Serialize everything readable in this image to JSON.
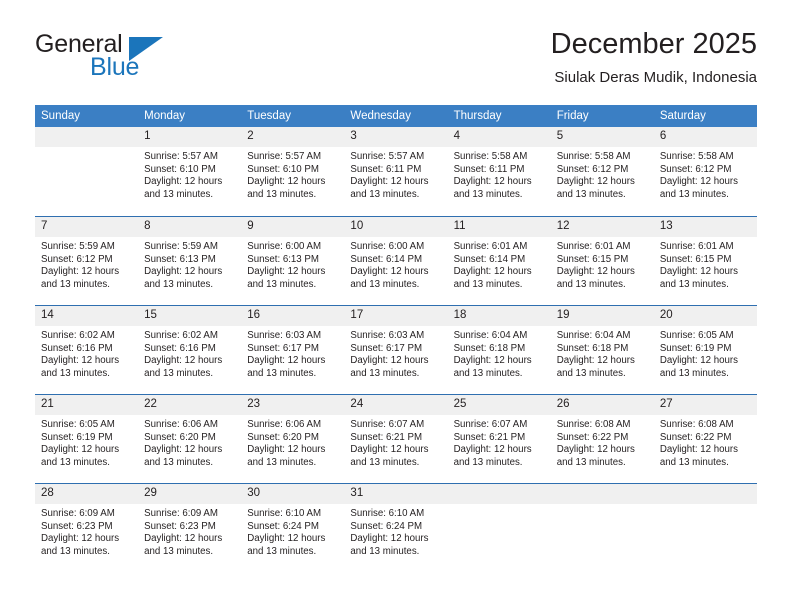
{
  "logo": {
    "word_top": "General",
    "word_bottom": "Blue",
    "triangle_color": "#1b75bb",
    "icon": "general-blue-logo"
  },
  "header": {
    "title": "December 2025",
    "subtitle": "Siulak Deras Mudik, Indonesia"
  },
  "theme": {
    "header_blue": "#3b7fc4",
    "row_divider_blue": "#2f6fb0",
    "daynum_background": "#f0f0f0",
    "text": "#231f20"
  },
  "calendar": {
    "weekday_headers": [
      "Sunday",
      "Monday",
      "Tuesday",
      "Wednesday",
      "Thursday",
      "Friday",
      "Saturday"
    ],
    "weeks": [
      [
        {
          "day": "",
          "lines": []
        },
        {
          "day": "1",
          "lines": [
            "Sunrise: 5:57 AM",
            "Sunset: 6:10 PM",
            "Daylight: 12 hours",
            "and 13 minutes."
          ]
        },
        {
          "day": "2",
          "lines": [
            "Sunrise: 5:57 AM",
            "Sunset: 6:10 PM",
            "Daylight: 12 hours",
            "and 13 minutes."
          ]
        },
        {
          "day": "3",
          "lines": [
            "Sunrise: 5:57 AM",
            "Sunset: 6:11 PM",
            "Daylight: 12 hours",
            "and 13 minutes."
          ]
        },
        {
          "day": "4",
          "lines": [
            "Sunrise: 5:58 AM",
            "Sunset: 6:11 PM",
            "Daylight: 12 hours",
            "and 13 minutes."
          ]
        },
        {
          "day": "5",
          "lines": [
            "Sunrise: 5:58 AM",
            "Sunset: 6:12 PM",
            "Daylight: 12 hours",
            "and 13 minutes."
          ]
        },
        {
          "day": "6",
          "lines": [
            "Sunrise: 5:58 AM",
            "Sunset: 6:12 PM",
            "Daylight: 12 hours",
            "and 13 minutes."
          ]
        }
      ],
      [
        {
          "day": "7",
          "lines": [
            "Sunrise: 5:59 AM",
            "Sunset: 6:12 PM",
            "Daylight: 12 hours",
            "and 13 minutes."
          ]
        },
        {
          "day": "8",
          "lines": [
            "Sunrise: 5:59 AM",
            "Sunset: 6:13 PM",
            "Daylight: 12 hours",
            "and 13 minutes."
          ]
        },
        {
          "day": "9",
          "lines": [
            "Sunrise: 6:00 AM",
            "Sunset: 6:13 PM",
            "Daylight: 12 hours",
            "and 13 minutes."
          ]
        },
        {
          "day": "10",
          "lines": [
            "Sunrise: 6:00 AM",
            "Sunset: 6:14 PM",
            "Daylight: 12 hours",
            "and 13 minutes."
          ]
        },
        {
          "day": "11",
          "lines": [
            "Sunrise: 6:01 AM",
            "Sunset: 6:14 PM",
            "Daylight: 12 hours",
            "and 13 minutes."
          ]
        },
        {
          "day": "12",
          "lines": [
            "Sunrise: 6:01 AM",
            "Sunset: 6:15 PM",
            "Daylight: 12 hours",
            "and 13 minutes."
          ]
        },
        {
          "day": "13",
          "lines": [
            "Sunrise: 6:01 AM",
            "Sunset: 6:15 PM",
            "Daylight: 12 hours",
            "and 13 minutes."
          ]
        }
      ],
      [
        {
          "day": "14",
          "lines": [
            "Sunrise: 6:02 AM",
            "Sunset: 6:16 PM",
            "Daylight: 12 hours",
            "and 13 minutes."
          ]
        },
        {
          "day": "15",
          "lines": [
            "Sunrise: 6:02 AM",
            "Sunset: 6:16 PM",
            "Daylight: 12 hours",
            "and 13 minutes."
          ]
        },
        {
          "day": "16",
          "lines": [
            "Sunrise: 6:03 AM",
            "Sunset: 6:17 PM",
            "Daylight: 12 hours",
            "and 13 minutes."
          ]
        },
        {
          "day": "17",
          "lines": [
            "Sunrise: 6:03 AM",
            "Sunset: 6:17 PM",
            "Daylight: 12 hours",
            "and 13 minutes."
          ]
        },
        {
          "day": "18",
          "lines": [
            "Sunrise: 6:04 AM",
            "Sunset: 6:18 PM",
            "Daylight: 12 hours",
            "and 13 minutes."
          ]
        },
        {
          "day": "19",
          "lines": [
            "Sunrise: 6:04 AM",
            "Sunset: 6:18 PM",
            "Daylight: 12 hours",
            "and 13 minutes."
          ]
        },
        {
          "day": "20",
          "lines": [
            "Sunrise: 6:05 AM",
            "Sunset: 6:19 PM",
            "Daylight: 12 hours",
            "and 13 minutes."
          ]
        }
      ],
      [
        {
          "day": "21",
          "lines": [
            "Sunrise: 6:05 AM",
            "Sunset: 6:19 PM",
            "Daylight: 12 hours",
            "and 13 minutes."
          ]
        },
        {
          "day": "22",
          "lines": [
            "Sunrise: 6:06 AM",
            "Sunset: 6:20 PM",
            "Daylight: 12 hours",
            "and 13 minutes."
          ]
        },
        {
          "day": "23",
          "lines": [
            "Sunrise: 6:06 AM",
            "Sunset: 6:20 PM",
            "Daylight: 12 hours",
            "and 13 minutes."
          ]
        },
        {
          "day": "24",
          "lines": [
            "Sunrise: 6:07 AM",
            "Sunset: 6:21 PM",
            "Daylight: 12 hours",
            "and 13 minutes."
          ]
        },
        {
          "day": "25",
          "lines": [
            "Sunrise: 6:07 AM",
            "Sunset: 6:21 PM",
            "Daylight: 12 hours",
            "and 13 minutes."
          ]
        },
        {
          "day": "26",
          "lines": [
            "Sunrise: 6:08 AM",
            "Sunset: 6:22 PM",
            "Daylight: 12 hours",
            "and 13 minutes."
          ]
        },
        {
          "day": "27",
          "lines": [
            "Sunrise: 6:08 AM",
            "Sunset: 6:22 PM",
            "Daylight: 12 hours",
            "and 13 minutes."
          ]
        }
      ],
      [
        {
          "day": "28",
          "lines": [
            "Sunrise: 6:09 AM",
            "Sunset: 6:23 PM",
            "Daylight: 12 hours",
            "and 13 minutes."
          ]
        },
        {
          "day": "29",
          "lines": [
            "Sunrise: 6:09 AM",
            "Sunset: 6:23 PM",
            "Daylight: 12 hours",
            "and 13 minutes."
          ]
        },
        {
          "day": "30",
          "lines": [
            "Sunrise: 6:10 AM",
            "Sunset: 6:24 PM",
            "Daylight: 12 hours",
            "and 13 minutes."
          ]
        },
        {
          "day": "31",
          "lines": [
            "Sunrise: 6:10 AM",
            "Sunset: 6:24 PM",
            "Daylight: 12 hours",
            "and 13 minutes."
          ]
        },
        {
          "day": "",
          "lines": []
        },
        {
          "day": "",
          "lines": []
        },
        {
          "day": "",
          "lines": []
        }
      ]
    ]
  }
}
